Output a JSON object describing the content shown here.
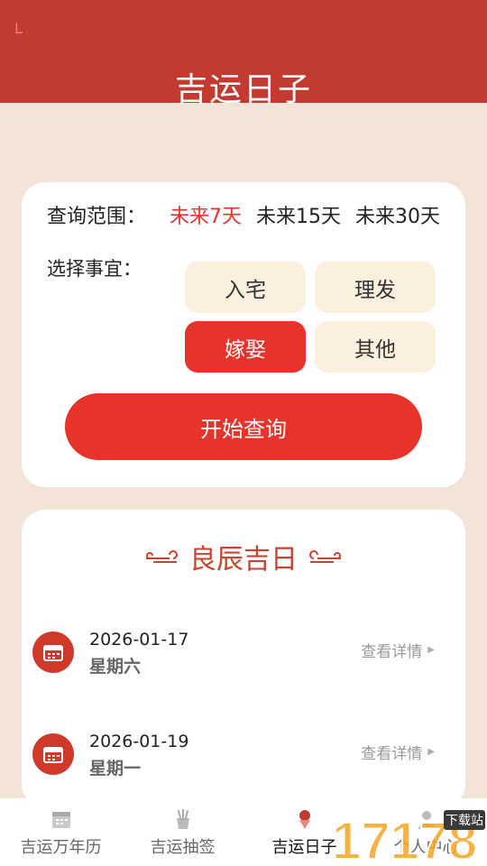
{
  "header": {
    "status_text": "L",
    "title": "吉运日子"
  },
  "query": {
    "range_label": "查询范围：",
    "range_options": [
      {
        "label": "未来7天",
        "active": true
      },
      {
        "label": "未来15天",
        "active": false
      },
      {
        "label": "未来30天",
        "active": false
      }
    ],
    "matter_label": "选择事宜：",
    "matters": [
      {
        "label": "入宅",
        "active": false
      },
      {
        "label": "理发",
        "active": false
      },
      {
        "label": "嫁娶",
        "active": true
      },
      {
        "label": "其他",
        "active": false
      }
    ],
    "start_button": "开始查询"
  },
  "results": {
    "title": "良辰吉日",
    "detail_label": "查看详情",
    "days": [
      {
        "date": "2026-01-17",
        "weekday": "星期六"
      },
      {
        "date": "2026-01-19",
        "weekday": "星期一"
      }
    ]
  },
  "tabbar": {
    "tabs": [
      {
        "label": "吉运万年历",
        "icon": "calendar-icon",
        "active": false
      },
      {
        "label": "吉运抽签",
        "icon": "lottery-sticks-icon",
        "active": false
      },
      {
        "label": "吉运日子",
        "icon": "lucky-day-icon",
        "active": true
      },
      {
        "label": "个人中心",
        "icon": "user-icon",
        "active": false
      }
    ]
  },
  "watermark": {
    "text": "17178",
    "badge": "下载站"
  },
  "colors": {
    "header": "#c23a30",
    "accent": "#e8332a",
    "background": "#f2e5d7",
    "chip": "#fbf0de"
  }
}
